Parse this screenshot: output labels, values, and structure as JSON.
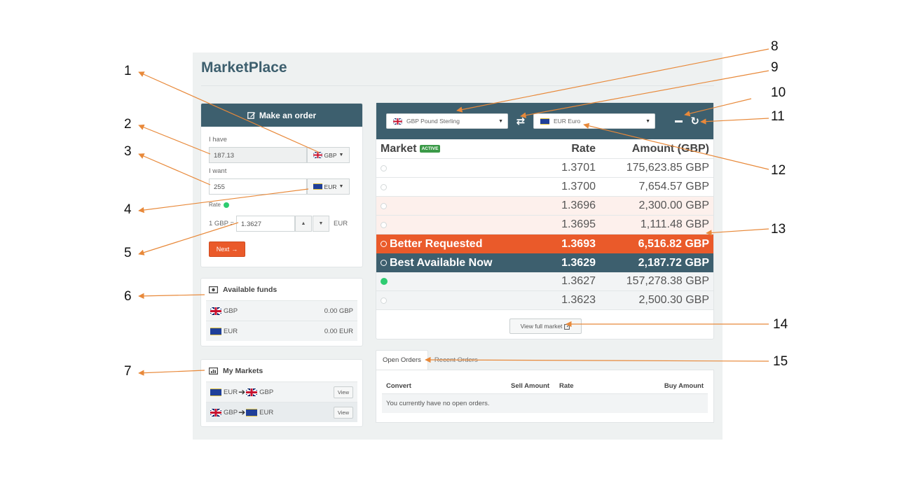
{
  "app": {
    "title": "MarketPlace"
  },
  "order_panel": {
    "title": "Make an order",
    "have_label": "I have",
    "have_value": "187.13",
    "have_currency": "GBP",
    "want_label": "I want",
    "want_value": "255",
    "want_currency": "EUR",
    "rate_label": "Rate",
    "rate_prefix": "1 GBP =",
    "rate_value": "1.3627",
    "rate_suffix": "EUR",
    "next_label": "Next"
  },
  "funds": {
    "title": "Available funds",
    "rows": [
      {
        "currency": "GBP",
        "amount": "0.00 GBP"
      },
      {
        "currency": "EUR",
        "amount": "0.00 EUR"
      }
    ]
  },
  "markets": {
    "title": "My Markets",
    "rows": [
      {
        "from": "EUR",
        "to": "GBP",
        "view_label": "View"
      },
      {
        "from": "GBP",
        "to": "EUR",
        "view_label": "View"
      }
    ]
  },
  "book": {
    "from_select": "GBP Pound Sterling",
    "to_select": "EUR Euro",
    "col_market": "Market",
    "badge": "ACTIVE",
    "col_rate": "Rate",
    "col_amount": "Amount (GBP)",
    "rows": [
      {
        "label": "",
        "rate": "1.3701",
        "amount": "175,623.85 GBP"
      },
      {
        "label": "",
        "rate": "1.3700",
        "amount": "7,654.57 GBP"
      },
      {
        "label": "",
        "rate": "1.3696",
        "amount": "2,300.00 GBP"
      },
      {
        "label": "",
        "rate": "1.3695",
        "amount": "1,111.48 GBP"
      },
      {
        "label": "Better Requested",
        "rate": "1.3693",
        "amount": "6,516.82 GBP"
      },
      {
        "label": "Best Available Now",
        "rate": "1.3629",
        "amount": "2,187.72 GBP"
      },
      {
        "label": "",
        "rate": "1.3627",
        "amount": "157,278.38 GBP"
      },
      {
        "label": "",
        "rate": "1.3623",
        "amount": "2,500.30 GBP"
      }
    ],
    "full_market_label": "View full market"
  },
  "orders": {
    "tabs": [
      "Open Orders",
      "Recent Orders"
    ],
    "col_convert": "Convert",
    "col_sell": "Sell Amount",
    "col_rate": "Rate",
    "col_buy": "Buy Amount",
    "empty_text": "You currently have no open orders."
  },
  "callouts": [
    "1",
    "2",
    "3",
    "4",
    "5",
    "6",
    "7",
    "8",
    "9",
    "10",
    "11",
    "12",
    "13",
    "14",
    "15"
  ],
  "colors": {
    "header": "#3d5f6e",
    "accent": "#ea5a2a",
    "callout_line": "#e8893a",
    "status_green": "#2ecc71"
  }
}
